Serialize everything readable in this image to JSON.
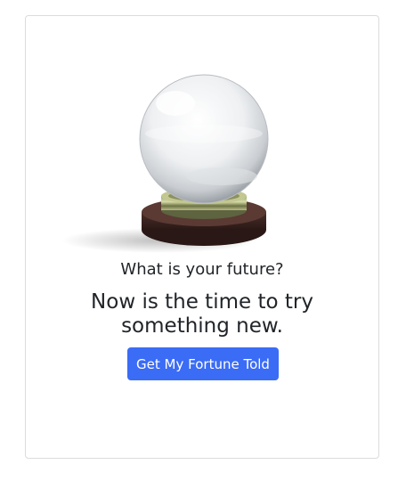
{
  "card": {
    "image_name": "crystal-ball-image",
    "question": "What is your future?",
    "fortune": "Now is the time to try something new.",
    "button_label": "Get My Fortune Told"
  },
  "colors": {
    "accent": "#3b6cf6",
    "text": "#212529",
    "border": "#dcdcdc"
  }
}
